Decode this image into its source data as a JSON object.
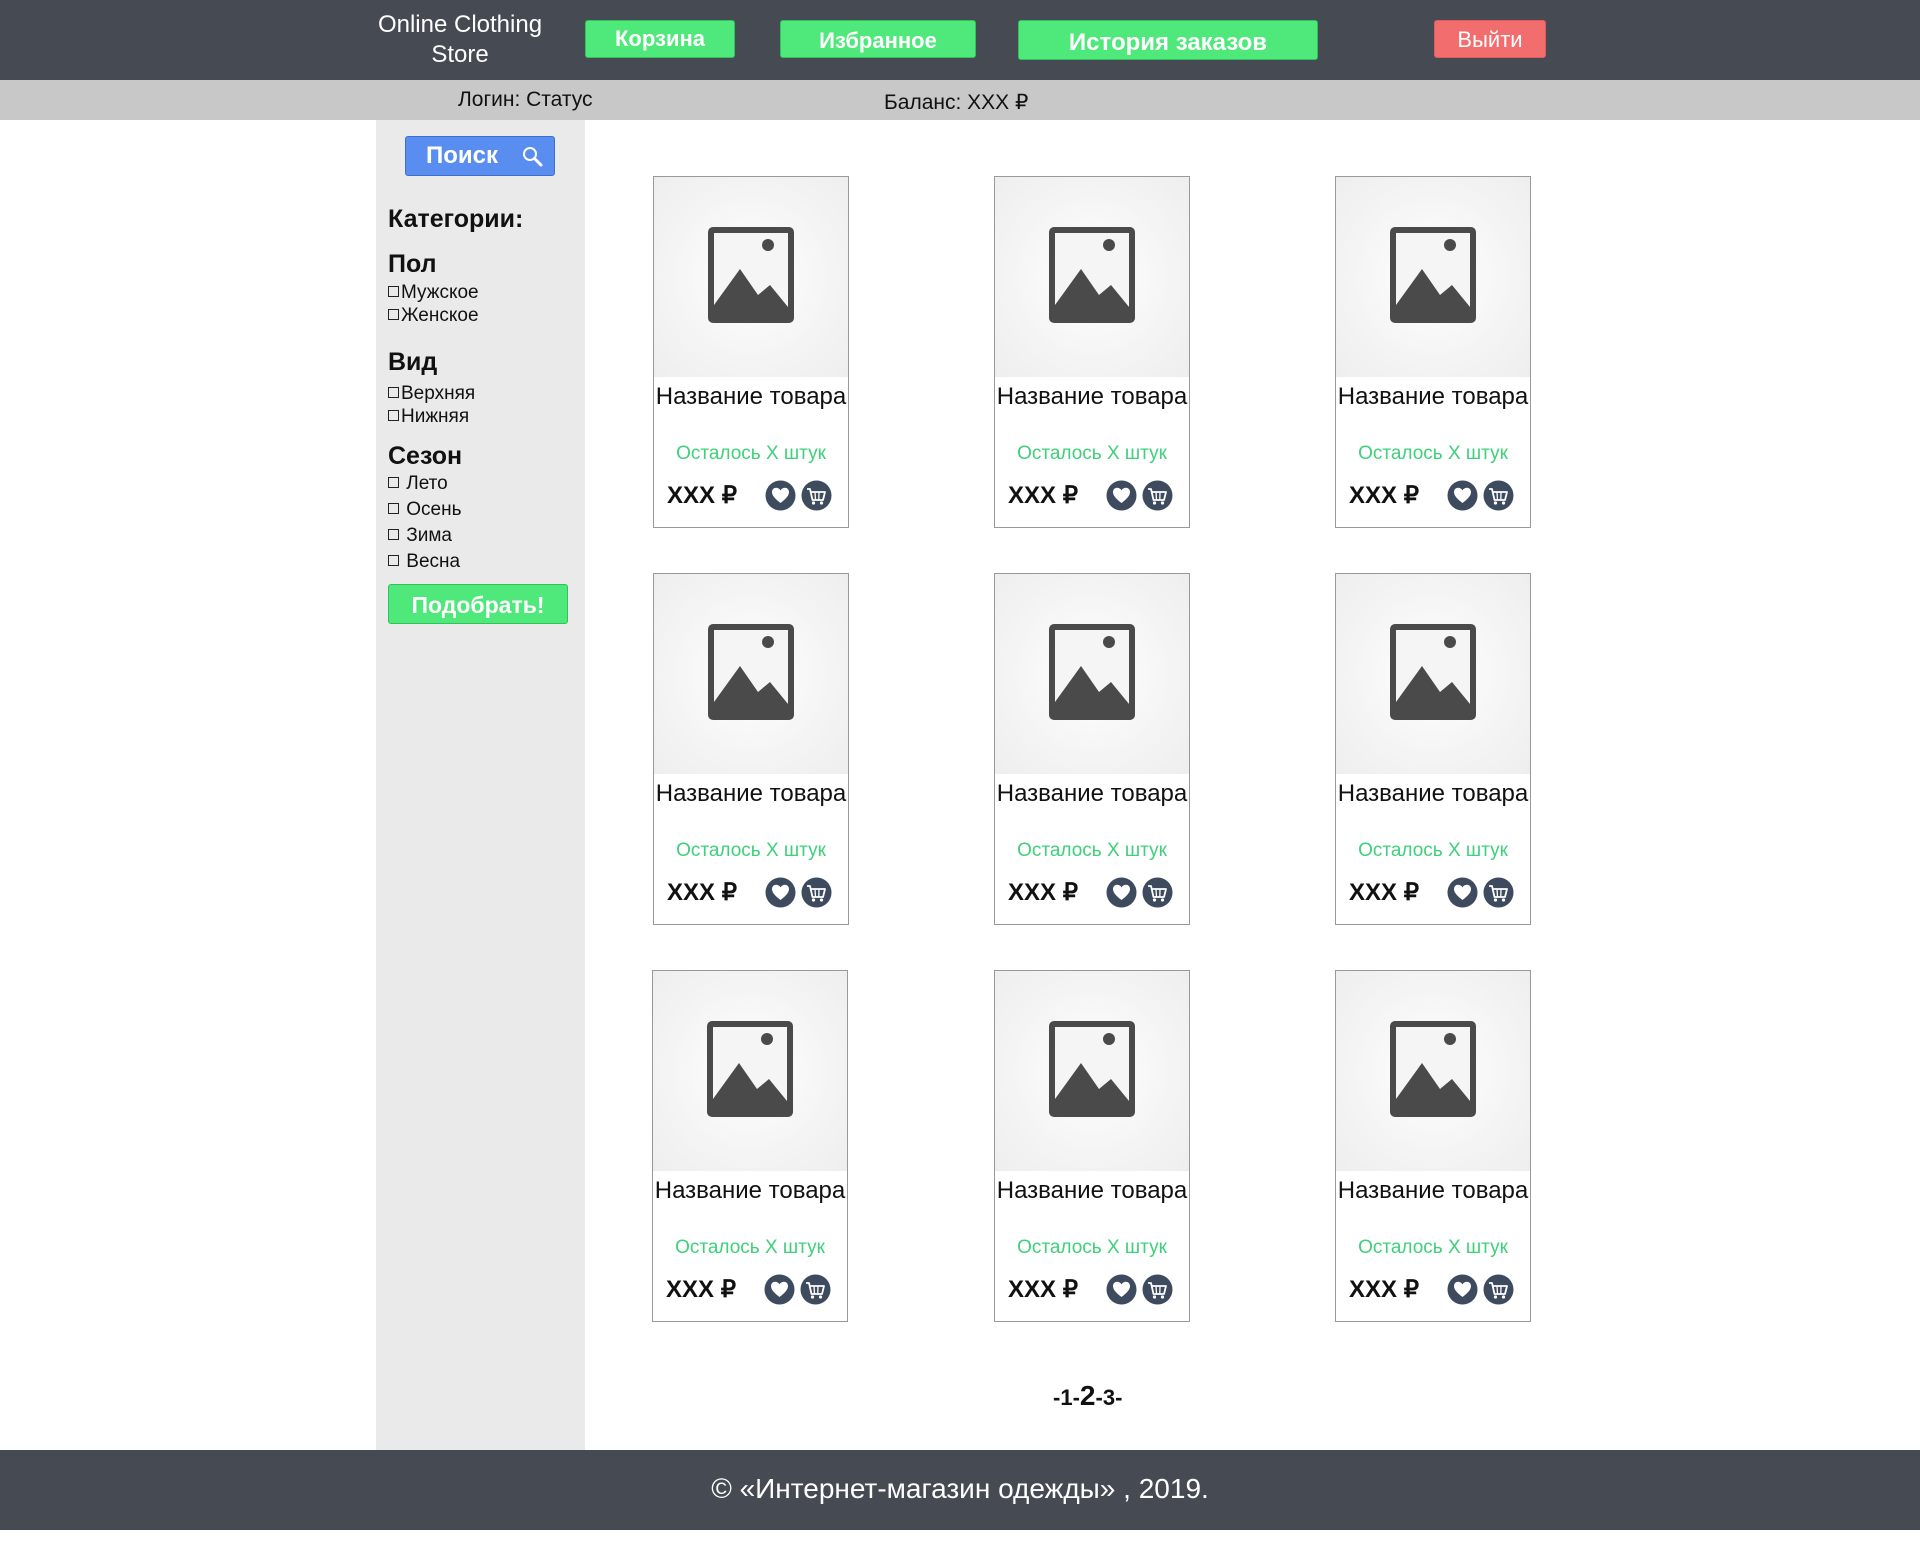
{
  "header": {
    "brand": "Online Clothing Store",
    "cart_label": "Корзина",
    "favorites_label": "Избранное",
    "history_label": "История заказов",
    "logout_label": "Выйти"
  },
  "status_bar": {
    "login": "Логин: Статус",
    "balance": "Баланс: XXX ₽"
  },
  "sidebar": {
    "search_label": "Поиск",
    "categories_title": "Категории:",
    "gender": {
      "title": "Пол",
      "options": [
        "Мужское",
        "Женское"
      ]
    },
    "type": {
      "title": "Вид",
      "options": [
        "Верхняя",
        "Нижняя"
      ]
    },
    "season": {
      "title": "Сезон",
      "options": [
        "Лето",
        "Осень",
        "Зима",
        "Весна"
      ]
    },
    "apply_label": "Подобрать!"
  },
  "products": [
    {
      "name": "Название товара",
      "stock": "Осталось X штук",
      "price": "XXX ₽"
    },
    {
      "name": "Название товара",
      "stock": "Осталось X штук",
      "price": "XXX ₽"
    },
    {
      "name": "Название товара",
      "stock": "Осталось X штук",
      "price": "XXX ₽"
    },
    {
      "name": "Название товара",
      "stock": "Осталось X штук",
      "price": "XXX ₽"
    },
    {
      "name": "Название товара",
      "stock": "Осталось X штук",
      "price": "XXX ₽"
    },
    {
      "name": "Название товара",
      "stock": "Осталось X штук",
      "price": "XXX ₽"
    },
    {
      "name": "Название товара",
      "stock": "Осталось X штук",
      "price": "XXX ₽"
    },
    {
      "name": "Название товара",
      "stock": "Осталось X штук",
      "price": "XXX ₽"
    },
    {
      "name": "Название товара",
      "stock": "Осталось X штук",
      "price": "XXX ₽"
    }
  ],
  "pagination": {
    "pages": [
      "1",
      "2",
      "3"
    ],
    "current": "2"
  },
  "footer": {
    "text": "© «Интернет-магазин одежды» , 2019."
  },
  "colors": {
    "header_bg": "#464a52",
    "accent_green": "#4fe87a",
    "logout_red": "#f16d6e",
    "search_blue": "#5a8df0",
    "stock_green": "#3ed07a",
    "icon_dark": "#3e4a5e"
  },
  "icons": {
    "product_image": "image-placeholder-icon",
    "favorite": "heart-icon",
    "basket": "basket-icon",
    "search": "magnifier-icon"
  }
}
